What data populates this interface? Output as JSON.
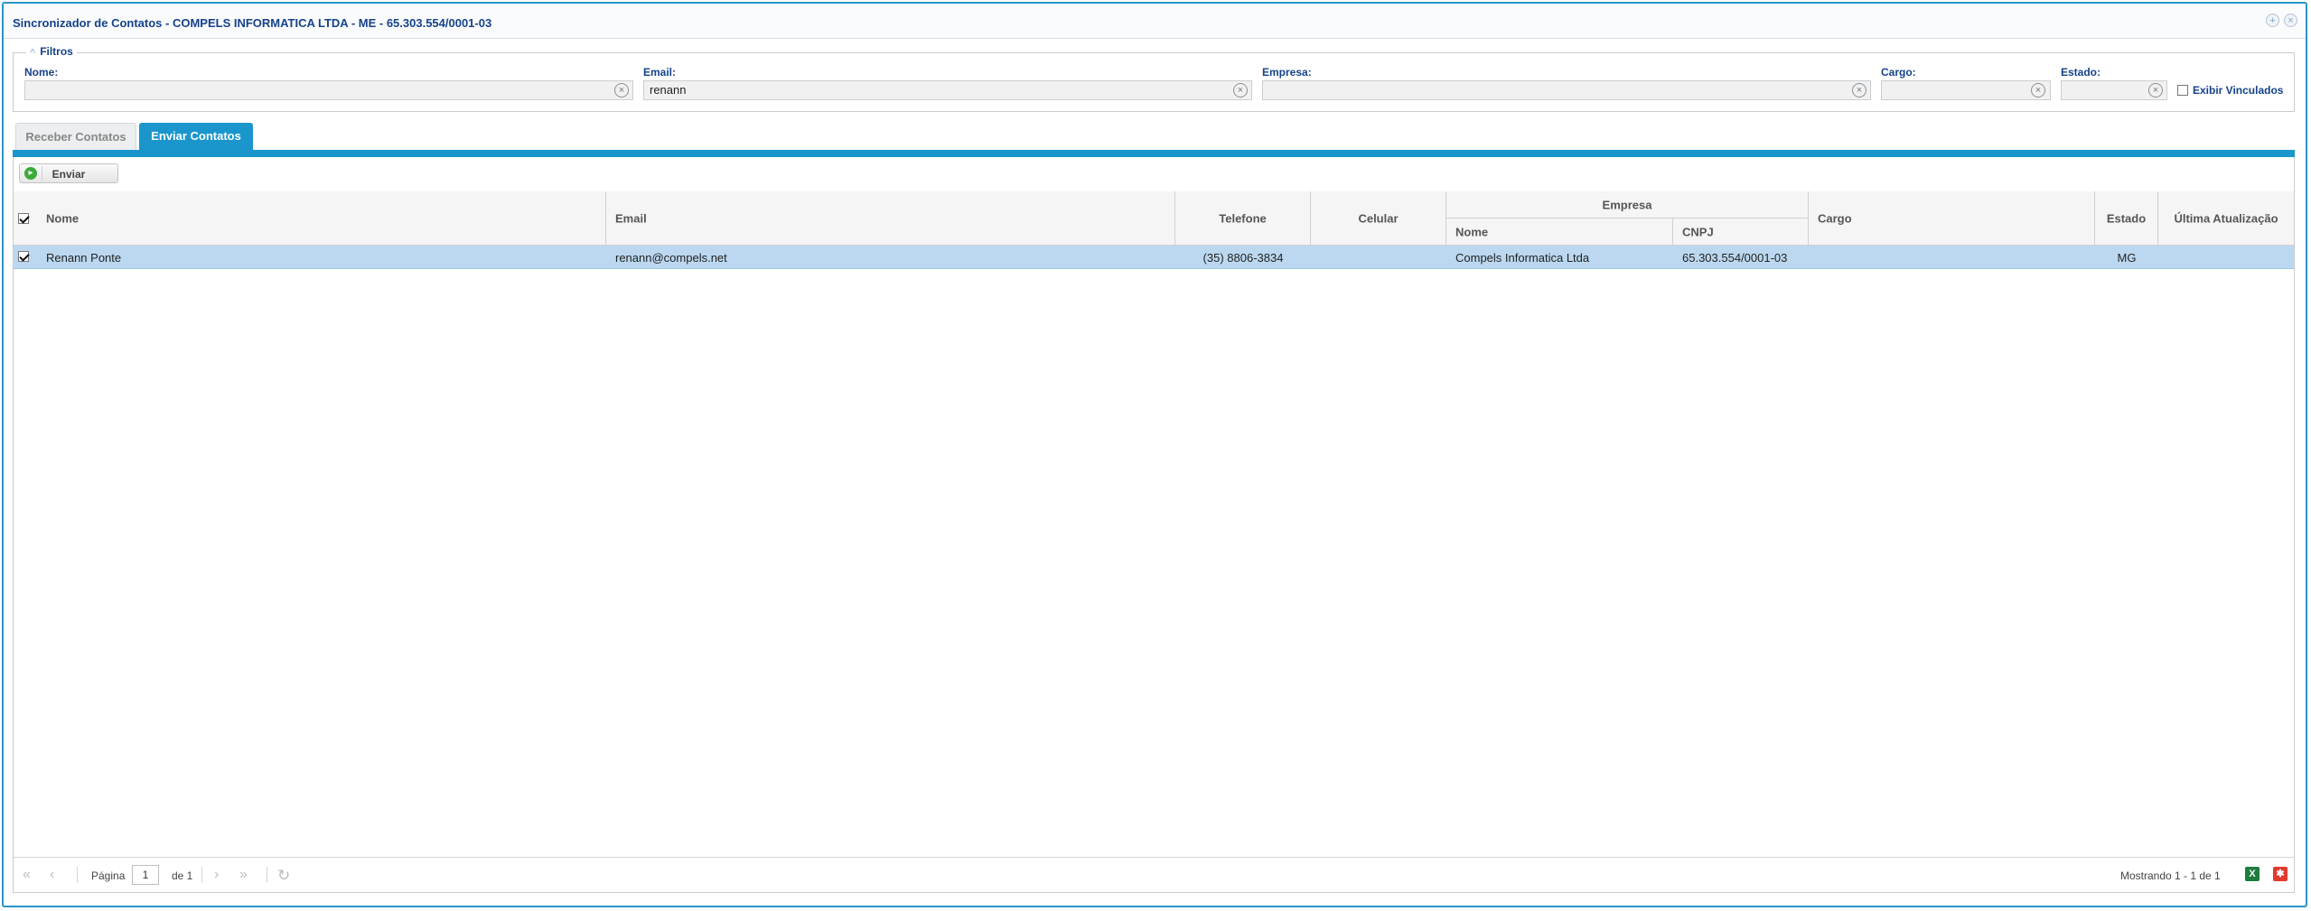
{
  "window": {
    "title": "Sincronizador de Contatos - COMPELS INFORMATICA LTDA - ME - 65.303.554/0001-03"
  },
  "filters": {
    "legend": "Filtros",
    "nome": {
      "label": "Nome:",
      "value": ""
    },
    "email": {
      "label": "Email:",
      "value": "renann"
    },
    "empresa": {
      "label": "Empresa:",
      "value": ""
    },
    "cargo": {
      "label": "Cargo:",
      "value": ""
    },
    "estado": {
      "label": "Estado:",
      "value": ""
    },
    "exibir_vinculados": {
      "label": "Exibir Vinculados",
      "checked": false
    }
  },
  "tabs": [
    {
      "label": "Receber Contatos",
      "active": false
    },
    {
      "label": "Enviar Contatos",
      "active": true
    }
  ],
  "toolbar": {
    "enviar_label": "Enviar"
  },
  "grid": {
    "headers": {
      "nome": "Nome",
      "email": "Email",
      "telefone": "Telefone",
      "celular": "Celular",
      "empresa": "Empresa",
      "empresa_nome": "Nome",
      "empresa_cnpj": "CNPJ",
      "cargo": "Cargo",
      "estado": "Estado",
      "ultima_atualizacao": "Última Atualização"
    },
    "rows": [
      {
        "checked": true,
        "nome": "Renann Ponte",
        "email": "renann@compels.net",
        "telefone": "(35) 8806-3834",
        "celular": "",
        "empresa_nome": "Compels Informatica Ltda",
        "empresa_cnpj": "65.303.554/0001-03",
        "cargo": "",
        "estado": "MG",
        "ultima_atualizacao": ""
      }
    ]
  },
  "paging": {
    "page_label": "Página",
    "page": "1",
    "of_label": "de 1",
    "display": "Mostrando 1 - 1 de 1"
  },
  "colors": {
    "accent": "#1a96cd",
    "title": "#15428b",
    "row_selected": "#bcd8f0"
  }
}
